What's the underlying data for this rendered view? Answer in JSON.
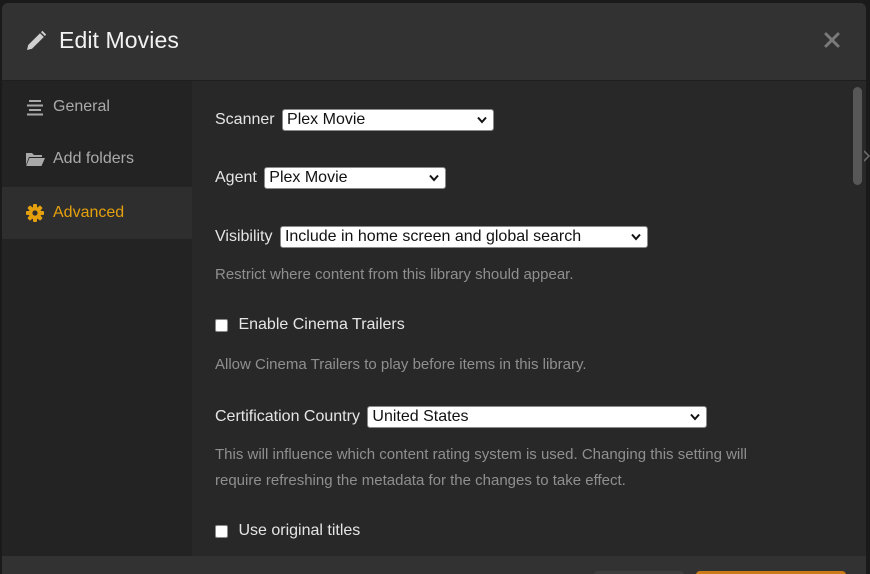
{
  "header": {
    "title": "Edit Movies",
    "icon": "pencil-icon",
    "close_icon": "close-icon"
  },
  "sidebar": {
    "items": [
      {
        "label": "General",
        "icon": "list-icon",
        "active": false
      },
      {
        "label": "Add folders",
        "icon": "folder-icon",
        "active": false
      },
      {
        "label": "Advanced",
        "icon": "gear-icon",
        "active": true
      }
    ]
  },
  "form": {
    "scanner": {
      "label": "Scanner",
      "value": "Plex Movie"
    },
    "agent": {
      "label": "Agent",
      "value": "Plex Movie"
    },
    "visibility": {
      "label": "Visibility",
      "value": "Include in home screen and global search",
      "help": "Restrict where content from this library should appear."
    },
    "cinema_trailers": {
      "label": "Enable Cinema Trailers",
      "checked": false,
      "help": "Allow Cinema Trailers to play before items in this library."
    },
    "certification_country": {
      "label": "Certification Country",
      "value": "United States",
      "help_line1": "This will influence which content rating system is used. Changing this setting will",
      "help_line2": "require refreshing the metadata for the changes to take effect."
    },
    "original_titles": {
      "label": "Use original titles",
      "checked": false
    }
  },
  "colors": {
    "accent": "#e5a00d",
    "background": "#282828",
    "sidebar": "#232323",
    "header": "#323232"
  }
}
